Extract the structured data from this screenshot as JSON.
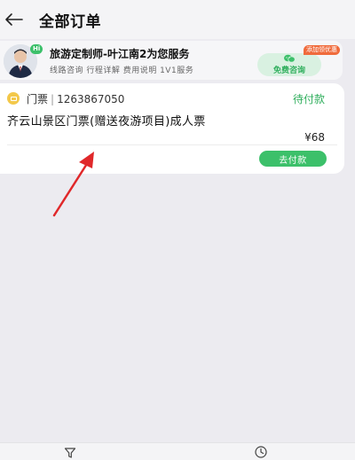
{
  "header": {
    "title": "全部订单"
  },
  "consultant": {
    "badge": "Hi",
    "title": "旅游定制师-叶江南2为您服务",
    "services": "线路咨询 行程详解 费用说明 1V1服务",
    "tag": "添加领优惠",
    "button_label": "免费咨询"
  },
  "order": {
    "type": "门票",
    "separator": "|",
    "order_id": "1263867050",
    "status": "待付款",
    "product_name": "齐云山景区门票(赠送夜游项目)成人票",
    "price": "¥68",
    "pay_button": "去付款"
  },
  "colors": {
    "accent_green": "#3cc06a",
    "status_green": "#2fae5c",
    "annotation_red": "#e0282a",
    "ticket_yellow": "#f3c84a"
  },
  "icons": {
    "back": "back-arrow-icon",
    "wechat": "wechat-icon",
    "ticket": "ticket-icon",
    "filter": "filter-icon",
    "clock": "clock-icon"
  }
}
